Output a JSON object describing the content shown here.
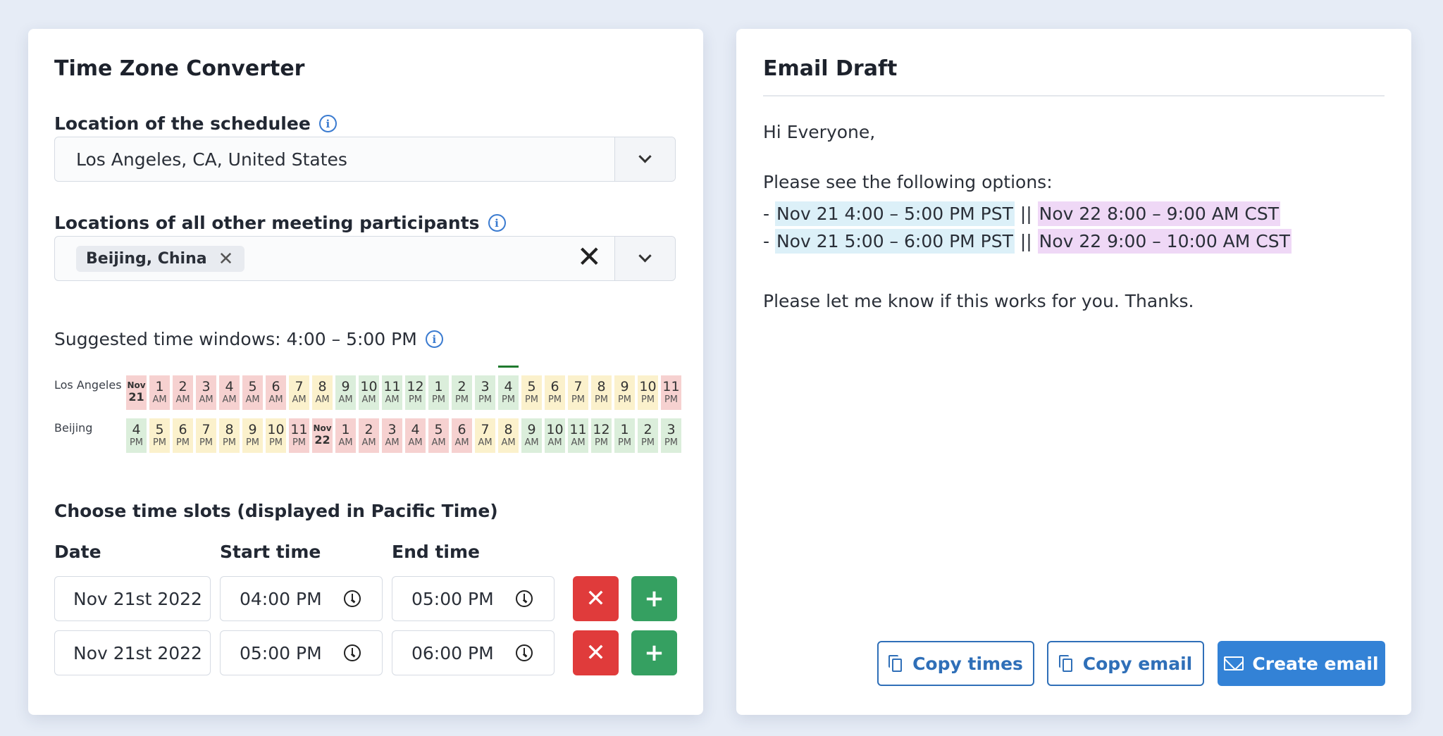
{
  "converter": {
    "title": "Time Zone Converter",
    "schedulee_label": "Location of the schedulee",
    "schedulee_value": "Los Angeles, CA, United States",
    "participants_label": "Locations of all other meeting participants",
    "participant_tag": "Beijing, China",
    "tag_remove": "✕",
    "clear_all": "✕",
    "info_icon": "i",
    "suggested": "Suggested time windows: 4:00 – 5:00 PM",
    "timeline": {
      "rows": [
        {
          "label": "Los Angeles",
          "cells": [
            {
              "h": "Nov",
              "s": "21",
              "c": "red",
              "date": true
            },
            {
              "h": "1",
              "s": "AM",
              "c": "red"
            },
            {
              "h": "2",
              "s": "AM",
              "c": "red"
            },
            {
              "h": "3",
              "s": "AM",
              "c": "red"
            },
            {
              "h": "4",
              "s": "AM",
              "c": "red"
            },
            {
              "h": "5",
              "s": "AM",
              "c": "red"
            },
            {
              "h": "6",
              "s": "AM",
              "c": "red"
            },
            {
              "h": "7",
              "s": "AM",
              "c": "yel"
            },
            {
              "h": "8",
              "s": "AM",
              "c": "yel"
            },
            {
              "h": "9",
              "s": "AM",
              "c": "grn"
            },
            {
              "h": "10",
              "s": "AM",
              "c": "grn"
            },
            {
              "h": "11",
              "s": "AM",
              "c": "grn"
            },
            {
              "h": "12",
              "s": "PM",
              "c": "grn"
            },
            {
              "h": "1",
              "s": "PM",
              "c": "grn"
            },
            {
              "h": "2",
              "s": "PM",
              "c": "grn"
            },
            {
              "h": "3",
              "s": "PM",
              "c": "grn"
            },
            {
              "h": "4",
              "s": "PM",
              "c": "grn"
            },
            {
              "h": "5",
              "s": "PM",
              "c": "yel"
            },
            {
              "h": "6",
              "s": "PM",
              "c": "yel"
            },
            {
              "h": "7",
              "s": "PM",
              "c": "yel"
            },
            {
              "h": "8",
              "s": "PM",
              "c": "yel"
            },
            {
              "h": "9",
              "s": "PM",
              "c": "yel"
            },
            {
              "h": "10",
              "s": "PM",
              "c": "yel"
            },
            {
              "h": "11",
              "s": "PM",
              "c": "red"
            }
          ]
        },
        {
          "label": "Beijing",
          "cells": [
            {
              "h": "4",
              "s": "PM",
              "c": "grn"
            },
            {
              "h": "5",
              "s": "PM",
              "c": "yel"
            },
            {
              "h": "6",
              "s": "PM",
              "c": "yel"
            },
            {
              "h": "7",
              "s": "PM",
              "c": "yel"
            },
            {
              "h": "8",
              "s": "PM",
              "c": "yel"
            },
            {
              "h": "9",
              "s": "PM",
              "c": "yel"
            },
            {
              "h": "10",
              "s": "PM",
              "c": "yel"
            },
            {
              "h": "11",
              "s": "PM",
              "c": "red"
            },
            {
              "h": "Nov",
              "s": "22",
              "c": "red",
              "date": true
            },
            {
              "h": "1",
              "s": "AM",
              "c": "red"
            },
            {
              "h": "2",
              "s": "AM",
              "c": "red"
            },
            {
              "h": "3",
              "s": "AM",
              "c": "red"
            },
            {
              "h": "4",
              "s": "AM",
              "c": "red"
            },
            {
              "h": "5",
              "s": "AM",
              "c": "red"
            },
            {
              "h": "6",
              "s": "AM",
              "c": "red"
            },
            {
              "h": "7",
              "s": "AM",
              "c": "yel"
            },
            {
              "h": "8",
              "s": "AM",
              "c": "yel"
            },
            {
              "h": "9",
              "s": "AM",
              "c": "grn"
            },
            {
              "h": "10",
              "s": "AM",
              "c": "grn"
            },
            {
              "h": "11",
              "s": "AM",
              "c": "grn"
            },
            {
              "h": "12",
              "s": "PM",
              "c": "grn"
            },
            {
              "h": "1",
              "s": "PM",
              "c": "grn"
            },
            {
              "h": "2",
              "s": "PM",
              "c": "grn"
            },
            {
              "h": "3",
              "s": "PM",
              "c": "grn"
            }
          ]
        }
      ],
      "marked_hour_index": 16
    },
    "slots_title": "Choose time slots (displayed in Pacific Time)",
    "col_date": "Date",
    "col_start": "Start time",
    "col_end": "End time",
    "slots": [
      {
        "date": "Nov 21st 2022",
        "start": "04:00  PM",
        "end": "05:00  PM"
      },
      {
        "date": "Nov 21st 2022",
        "start": "05:00  PM",
        "end": "06:00  PM"
      }
    ],
    "remove_symbol": "✕",
    "add_symbol": "+"
  },
  "email": {
    "title": "Email Draft",
    "greeting": "Hi Everyone,",
    "intro": "Please see the following options:",
    "options": [
      {
        "prefix": "- ",
        "local": "Nov 21 4:00 – 5:00 PM PST",
        "sep": " || ",
        "other": "Nov 22 8:00 – 9:00 AM CST"
      },
      {
        "prefix": "- ",
        "local": "Nov 21 5:00 – 6:00 PM PST",
        "sep": " || ",
        "other": "Nov 22 9:00 – 10:00 AM CST"
      }
    ],
    "closing": "Please let me know if this works for you. Thanks.",
    "copy_times": "Copy times",
    "copy_email": "Copy email",
    "create_email": "Create email"
  },
  "colors": {
    "primary": "#3382d6",
    "danger": "#e03b3b",
    "success": "#35a061",
    "highlight_local": "#dcf0f8",
    "highlight_other": "#efd8f6"
  }
}
